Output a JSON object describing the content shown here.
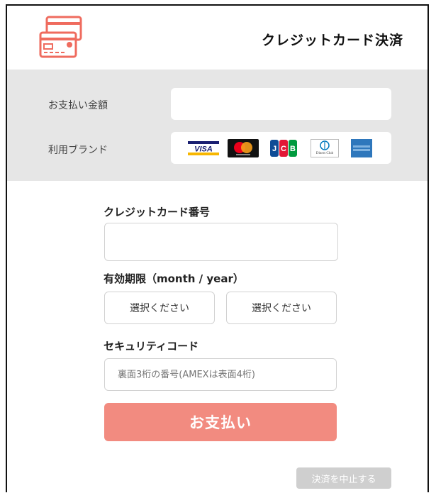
{
  "header": {
    "title": "クレジットカード決済",
    "logo_icon": "credit-card-icon",
    "accent_color": "#ef6b5e"
  },
  "summary": {
    "amount_label": "お支払い金額",
    "amount_value": "",
    "brand_label": "利用ブランド",
    "brands": [
      "VISA",
      "Mastercard",
      "JCB",
      "Diners Club",
      "AMEX"
    ]
  },
  "card_number": {
    "label": "クレジットカード番号",
    "value": ""
  },
  "expiry": {
    "label": "有効期限（month / year）",
    "month_selected": "選択ください",
    "year_selected": "選択ください"
  },
  "security_code": {
    "label": "セキュリティコード",
    "placeholder": "裏面3桁の番号(AMEXは表面4桁)"
  },
  "actions": {
    "pay_label": "お支払い",
    "pay_color": "#f28b80",
    "cancel_label": "決済を中止する",
    "cancel_color": "#cfcfcf"
  }
}
